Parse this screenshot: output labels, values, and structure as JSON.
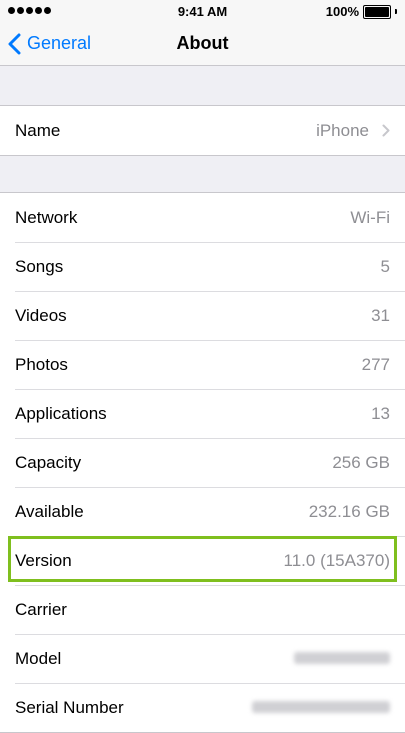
{
  "status_bar": {
    "time": "9:41 AM",
    "battery_text": "100%",
    "signal_icon": "signal-dots-icon",
    "battery_icon": "battery-icon"
  },
  "nav": {
    "back_label": "General",
    "back_icon": "chevron-left-icon",
    "title": "About",
    "accent": "#007aff"
  },
  "name_row": {
    "label": "Name",
    "value": "iPhone",
    "icon": "chevron-right-icon"
  },
  "info_rows": [
    {
      "label": "Network",
      "value": "Wi-Fi"
    },
    {
      "label": "Songs",
      "value": "5"
    },
    {
      "label": "Videos",
      "value": "31"
    },
    {
      "label": "Photos",
      "value": "277"
    },
    {
      "label": "Applications",
      "value": "13"
    },
    {
      "label": "Capacity",
      "value": "256 GB"
    },
    {
      "label": "Available",
      "value": "232.16 GB"
    },
    {
      "label": "Version",
      "value": "11.0 (15A370)",
      "highlighted": true
    },
    {
      "label": "Carrier",
      "value": ""
    },
    {
      "label": "Model",
      "value": "",
      "redacted": true
    },
    {
      "label": "Serial Number",
      "value": "",
      "redacted": true
    }
  ],
  "highlight_color": "#7fbf1e"
}
